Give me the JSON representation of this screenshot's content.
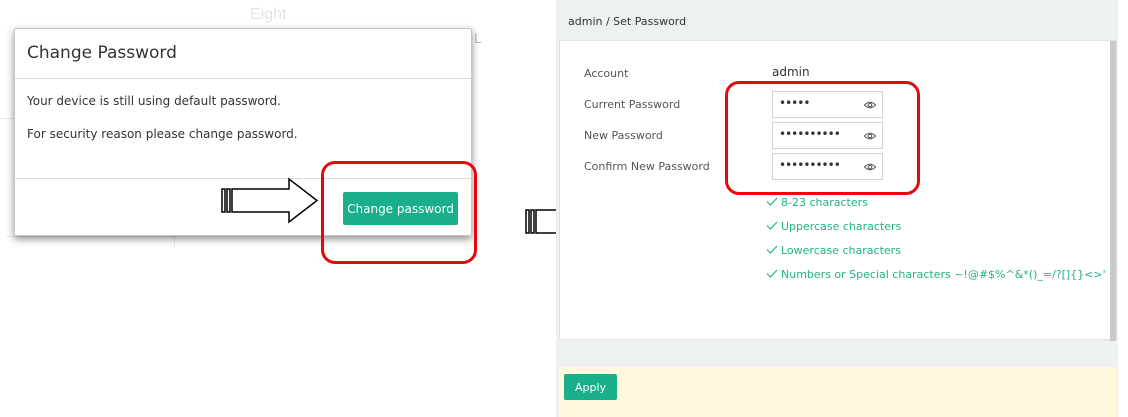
{
  "dialog": {
    "title": "Change Password",
    "message_1": "Your device is still using default password.",
    "message_2": "For security reason please change password.",
    "change_button": "Change password"
  },
  "background": {
    "ghost_text": "Eight",
    "ghost_mark": "L"
  },
  "panel": {
    "breadcrumb": "admin / Set Password",
    "labels": {
      "account": "Account",
      "current_password": "Current Password",
      "new_password": "New Password",
      "confirm_password": "Confirm New Password"
    },
    "account_value": "admin",
    "current_password_value": "•••••",
    "new_password_value": "••••••••••",
    "confirm_password_value": "••••••••••",
    "rules": [
      "8-23 characters",
      "Uppercase characters",
      "Lowercase characters",
      "Numbers or Special characters ~!@#$%^&*()_=/?[]{}<>'"
    ],
    "apply_button": "Apply"
  },
  "colors": {
    "accent": "#1aaf8b",
    "rule_text": "#23b088",
    "highlight": "#e8070d",
    "apply_bar": "#fff8dd",
    "panel_bg": "#eef1f2"
  },
  "icons": [
    "eye-icon",
    "check-icon",
    "arrow-right-icon"
  ]
}
